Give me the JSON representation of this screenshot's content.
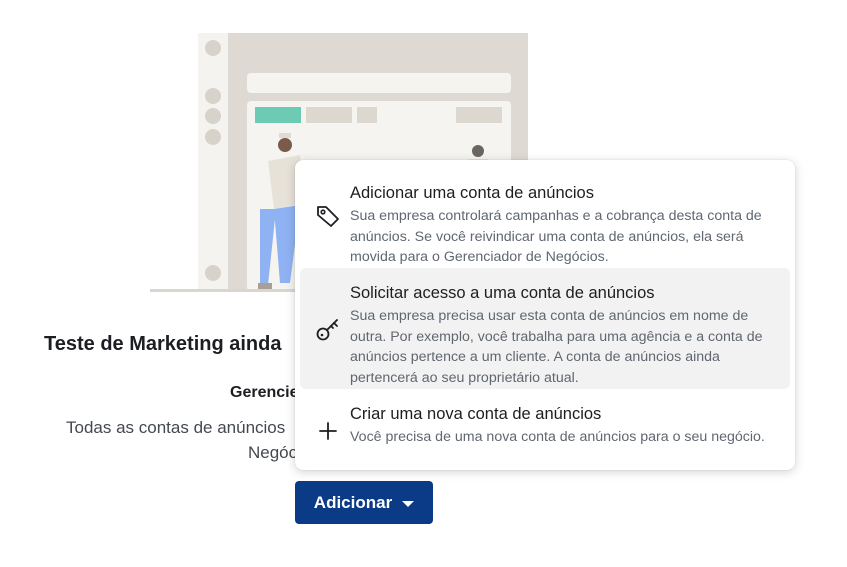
{
  "page": {
    "title": "Teste de Marketing ainda",
    "subtitle": "Gerencie",
    "description_line1": "Todas as contas de anúncios",
    "description_line2": "Negóc"
  },
  "add_button": {
    "label": "Adicionar",
    "icon": "caret-down-icon"
  },
  "menu": {
    "options": [
      {
        "title": "Adicionar uma conta de anúncios",
        "description": "Sua empresa controlará campanhas e a cobrança desta conta de anúncios. Se você reivindicar uma conta de anúncios, ela será movida para o Gerenciador de Negócios.",
        "icon": "tag-icon"
      },
      {
        "title": "Solicitar acesso a uma conta de anúncios",
        "description": "Sua empresa precisa usar esta conta de anúncios em nome de outra. Por exemplo, você trabalha para uma agência e a conta de anúncios pertence a um cliente. A conta de anúncios ainda pertencerá ao seu proprietário atual.",
        "icon": "key-icon"
      },
      {
        "title": "Criar uma nova conta de anúncios",
        "description": "Você precisa de uma nova conta de anúncios para o seu negócio.",
        "icon": "plus-icon"
      }
    ]
  },
  "colors": {
    "button_bg": "#0b3a86",
    "highlight_bg": "#f2f2f2",
    "illustration_frame": "#d9d6cf",
    "illustration_accent": "#6dcbb4",
    "figure_pants": "#8fb2f3"
  }
}
